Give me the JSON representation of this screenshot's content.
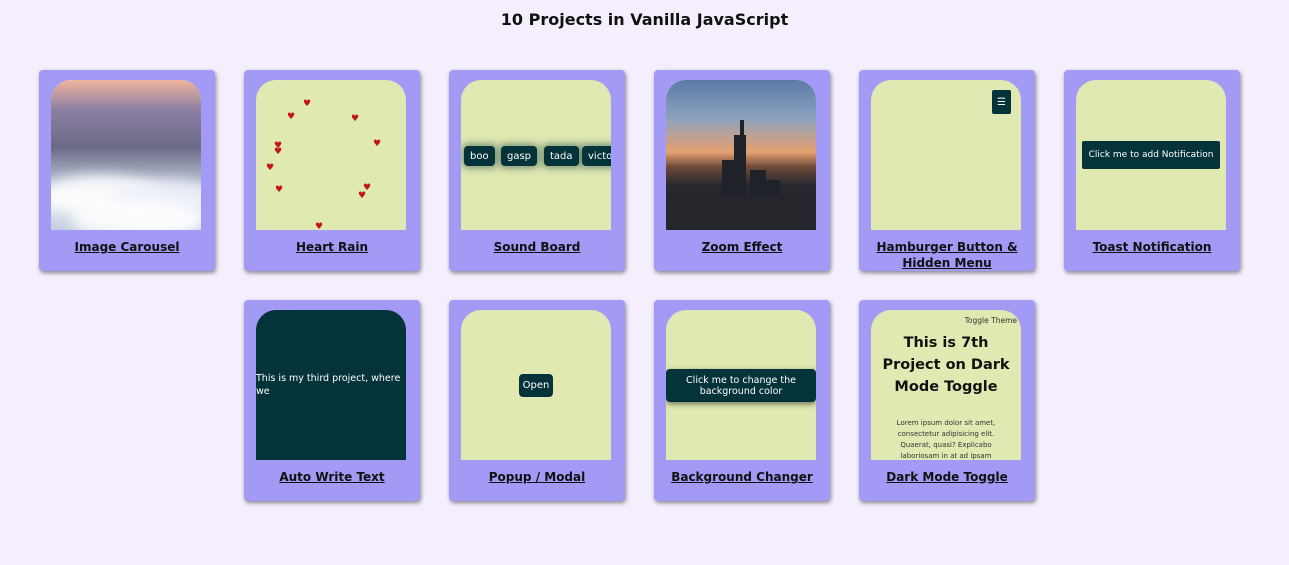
{
  "page": {
    "title": "10 Projects in Vanilla JavaScript"
  },
  "cards": [
    {
      "label": "Image Carousel"
    },
    {
      "label": "Heart Rain"
    },
    {
      "label": "Sound Board"
    },
    {
      "label": "Zoom Effect"
    },
    {
      "label": "Hamburger Button & Hidden Menu"
    },
    {
      "label": "Toast Notification"
    },
    {
      "label": "Auto Write Text"
    },
    {
      "label": "Popup / Modal"
    },
    {
      "label": "Background Changer"
    },
    {
      "label": "Dark Mode Toggle"
    }
  ],
  "sound_board": {
    "buttons": [
      "boo",
      "gasp",
      "tada",
      "victory"
    ]
  },
  "hamburger": {
    "icon_glyph": "☰"
  },
  "toast": {
    "button_label": "Click me to add Notification"
  },
  "auto_write": {
    "text": "This is my third project, where we"
  },
  "popup": {
    "button_label": "Open"
  },
  "bg_changer": {
    "button_label": "Click me to change the background color"
  },
  "dark_mode": {
    "toggle_label": "Toggle Theme",
    "heading": "This is 7th Project on Dark Mode Toggle",
    "body": "Lorem ipsum dolor sit amet, consectetur adipisicing elit. Quaerat, quasi? Explicabo laboriosam in at ad ipsam"
  },
  "colors": {
    "background": "#f5effd",
    "card": "#a39af5",
    "preview": "#e1e9b2",
    "dark_button": "#05333a",
    "heart": "#c01616"
  }
}
